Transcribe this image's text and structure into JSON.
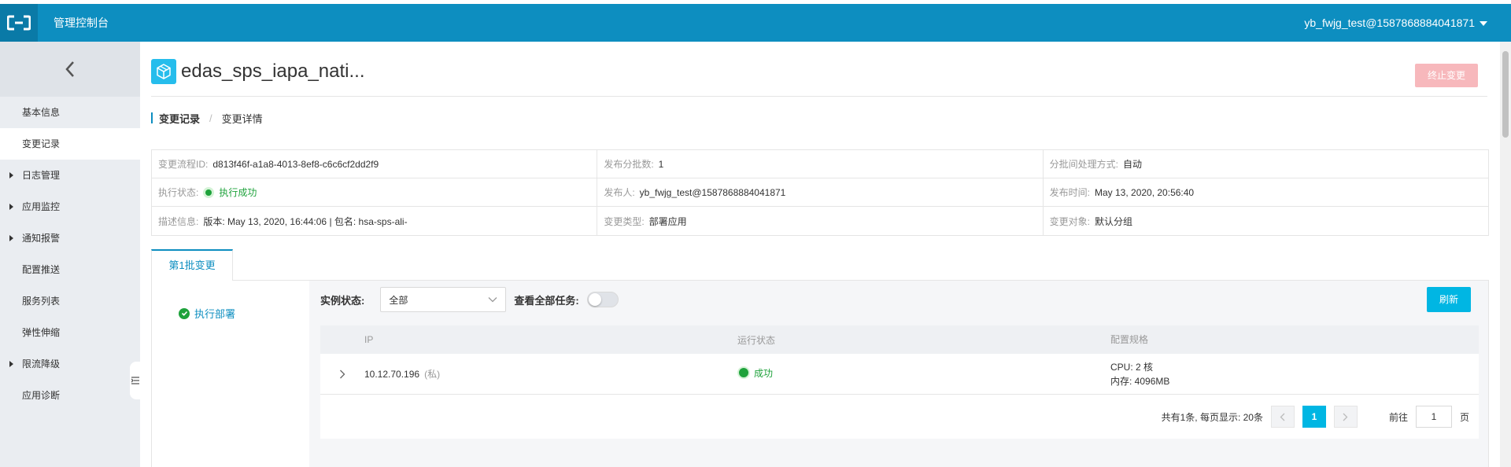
{
  "header": {
    "console_title": "管理控制台",
    "user": "yb_fwjg_test@1587868884041871"
  },
  "sidebar": {
    "items": [
      {
        "label": "基本信息",
        "expandable": false,
        "active": false
      },
      {
        "label": "变更记录",
        "expandable": false,
        "active": true
      },
      {
        "label": "日志管理",
        "expandable": true,
        "active": false
      },
      {
        "label": "应用监控",
        "expandable": true,
        "active": false
      },
      {
        "label": "通知报警",
        "expandable": true,
        "active": false
      },
      {
        "label": "配置推送",
        "expandable": false,
        "active": false
      },
      {
        "label": "服务列表",
        "expandable": false,
        "active": false
      },
      {
        "label": "弹性伸缩",
        "expandable": false,
        "active": false
      },
      {
        "label": "限流降级",
        "expandable": true,
        "active": false
      },
      {
        "label": "应用诊断",
        "expandable": false,
        "active": false
      }
    ]
  },
  "page": {
    "app_title": "edas_sps_iapa_nati...",
    "stop_button": "终止变更",
    "breadcrumb": {
      "current": "变更记录",
      "separator": "/",
      "next": "变更详情"
    }
  },
  "info": {
    "flow_id_label": "变更流程ID:",
    "flow_id": "d813f46f-a1a8-4013-8ef8-c6c6cf2dd2f9",
    "batch_count_label": "发布分批数:",
    "batch_count": "1",
    "batch_mode_label": "分批间处理方式:",
    "batch_mode": "自动",
    "exec_status_label": "执行状态:",
    "exec_status": "执行成功",
    "publisher_label": "发布人:",
    "publisher": "yb_fwjg_test@1587868884041871",
    "publish_time_label": "发布时间:",
    "publish_time": "May 13, 2020, 20:56:40",
    "desc_label": "描述信息:",
    "desc": "版本: May 13, 2020, 16:44:06 | 包名: hsa-sps-ali-",
    "change_type_label": "变更类型:",
    "change_type": "部署应用",
    "change_target_label": "变更对象:",
    "change_target": "默认分组"
  },
  "batch": {
    "tab_label": "第1批变更",
    "step_label": "执行部署",
    "filter_label": "实例状态:",
    "filter_value": "全部",
    "show_all_label": "查看全部任务:",
    "refresh_button": "刷新",
    "columns": [
      "IP",
      "运行状态",
      "配置规格"
    ],
    "rows": [
      {
        "ip": "10.12.70.196",
        "ip_type": "(私)",
        "status": "成功",
        "cpu": "CPU: 2 核",
        "memory": "内存:  4096MB"
      }
    ],
    "pager": {
      "summary": "共有1条,  每页显示: 20条",
      "current_page": "1",
      "goto_label": "前往",
      "goto_value": "1",
      "page_suffix": "页"
    }
  },
  "colors": {
    "topbar": "#0d8ec0",
    "accent": "#00b6e3",
    "success": "#1ea23b",
    "stop_button": "#f7b8bc"
  }
}
